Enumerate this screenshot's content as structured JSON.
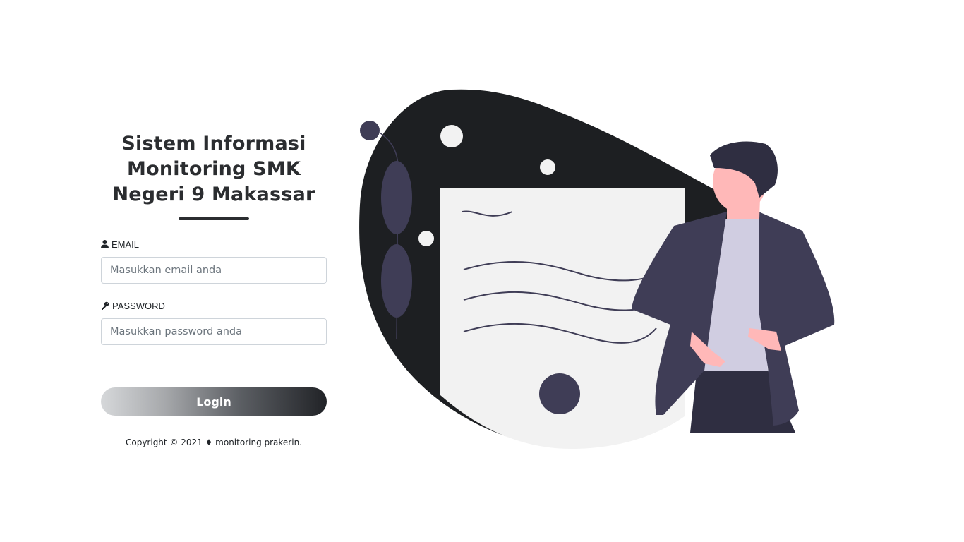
{
  "login": {
    "title_lines": [
      "Sistem Informasi",
      "Monitoring SMK",
      "Negeri 9 Makassar"
    ],
    "email": {
      "label": "EMAIL",
      "icon": "user-icon",
      "placeholder": "Masukkan email anda",
      "value": ""
    },
    "password": {
      "label": "PASSWORD",
      "icon": "key-icon",
      "placeholder": "Masukkan password anda",
      "value": ""
    },
    "button_label": "Login",
    "copyright": "Copyright © 2021 ♦ monitoring prakerin."
  },
  "illustration": {
    "subject": "man-with-document-illustration",
    "colors": {
      "blob": "#1d1f22",
      "paper": "#f2f2f2",
      "ink": "#3f3d56",
      "jacket": "#3f3d56",
      "shirt": "#d0cde1",
      "skin": "#ffb8b8",
      "hair": "#2f2e41",
      "trousers": "#2f2e41"
    }
  }
}
